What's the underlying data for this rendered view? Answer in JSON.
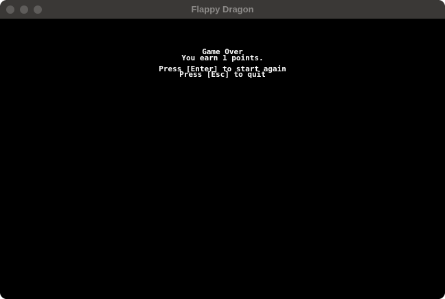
{
  "window": {
    "title": "Flappy Dragon"
  },
  "game": {
    "game_over": "Game Over",
    "score_message": "You earn 1 points.",
    "restart_prompt": "Press [Enter] to start again",
    "quit_prompt": "Press [Esc] to quit"
  },
  "colors": {
    "titlebar": "#3a3836",
    "title_text": "#8c8a88",
    "background": "#000000",
    "text": "#ffffff"
  }
}
